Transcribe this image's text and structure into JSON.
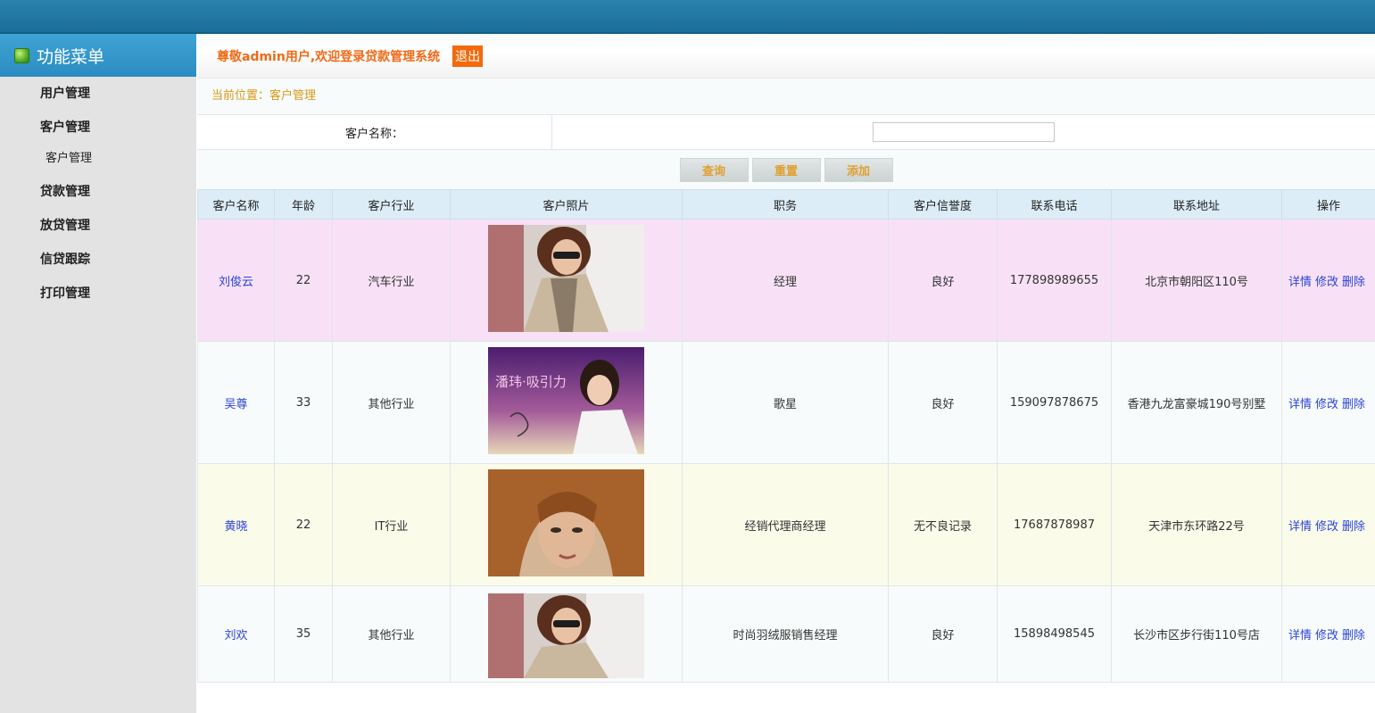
{
  "sidebar": {
    "title": "功能菜单",
    "items": [
      {
        "label": "用户管理"
      },
      {
        "label": "客户管理"
      },
      {
        "label": "客户管理",
        "sub": true
      },
      {
        "label": "贷款管理"
      },
      {
        "label": "放贷管理"
      },
      {
        "label": "信贷跟踪"
      },
      {
        "label": "打印管理"
      }
    ]
  },
  "header": {
    "welcome": "尊敬admin用户,欢迎登录贷款管理系统",
    "logout": "退出"
  },
  "breadcrumb": "当前位置：客户管理",
  "search": {
    "label": "客户名称：",
    "value": "",
    "buttons": {
      "query": "查询",
      "reset": "重置",
      "add": "添加"
    }
  },
  "table": {
    "columns": [
      "客户名称",
      "年龄",
      "客户行业",
      "客户照片",
      "职务",
      "客户信誉度",
      "联系电话",
      "联系地址",
      "操作"
    ],
    "rows": [
      {
        "name": "刘俊云",
        "age": "22",
        "industry": "汽车行业",
        "photo": "woman-sunglasses-photo",
        "position": "经理",
        "credit": "良好",
        "phone": "177898989655",
        "address": "北京市朝阳区110号"
      },
      {
        "name": "吴尊",
        "age": "33",
        "industry": "其他行业",
        "photo": "album-cover-photo",
        "position": "歌星",
        "credit": "良好",
        "phone": "159097878675",
        "address": "香港九龙富豪城190号别墅"
      },
      {
        "name": "黄晓",
        "age": "22",
        "industry": "IT行业",
        "photo": "woman-hair-photo",
        "position": "经销代理商经理",
        "credit": "无不良记录",
        "phone": "17687878987",
        "address": "天津市东环路22号"
      },
      {
        "name": "刘欢",
        "age": "35",
        "industry": "其他行业",
        "photo": "woman-sunglasses-photo",
        "position": "时尚羽绒服销售经理",
        "credit": "良好",
        "phone": "15898498545",
        "address": "长沙市区步行街110号店"
      }
    ],
    "ops": {
      "detail": "详情",
      "edit": "修改",
      "delete": "删除"
    },
    "album_text": "潘玮·吸引力"
  }
}
